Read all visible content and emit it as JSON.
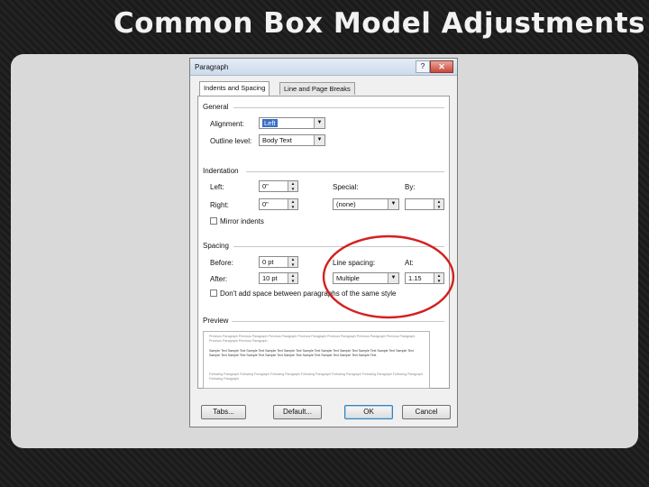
{
  "slide": {
    "title": "Common Box Model Adjustments"
  },
  "dialog": {
    "title": "Paragraph",
    "help_label": "?",
    "close_label": "✕",
    "tabs": [
      {
        "label": "Indents and Spacing",
        "active": true
      },
      {
        "label": "Line and Page Breaks",
        "active": false
      }
    ],
    "general": {
      "heading": "General",
      "alignment_label": "Alignment:",
      "alignment_value": "Left",
      "outline_label": "Outline level:",
      "outline_value": "Body Text"
    },
    "indentation": {
      "heading": "Indentation",
      "left_label": "Left:",
      "left_value": "0\"",
      "right_label": "Right:",
      "right_value": "0\"",
      "special_label": "Special:",
      "special_value": "(none)",
      "by_label": "By:",
      "by_value": "",
      "mirror_label": "Mirror indents"
    },
    "spacing": {
      "heading": "Spacing",
      "before_label": "Before:",
      "before_value": "0 pt",
      "after_label": "After:",
      "after_value": "10 pt",
      "line_spacing_label": "Line spacing:",
      "line_spacing_value": "Multiple",
      "at_label": "At:",
      "at_value": "1.15",
      "dont_add_label": "Don't add space between paragraphs of the same style"
    },
    "preview": {
      "heading": "Preview",
      "previous_text": "Previous Paragraph Previous Paragraph Previous Paragraph Previous Paragraph Previous Paragraph Previous Paragraph Previous Paragraph Previous Paragraph Previous Paragraph",
      "sample_text": "Sample Text Sample Text Sample Text Sample Text Sample Text Sample Text Sample Text Sample Text Sample Text Sample Text Sample Text Sample Text Sample Text Sample Text Sample Text Sample Text Sample Text Sample Text Sample Text Sample Text",
      "following_text": "Following Paragraph Following Paragraph Following Paragraph Following Paragraph Following Paragraph Following Paragraph Following Paragraph Following Paragraph"
    },
    "buttons": {
      "tabs_label": "Tabs...",
      "default_label": "Default...",
      "ok_label": "OK",
      "cancel_label": "Cancel"
    }
  },
  "annotation": {
    "color": "#d42020"
  }
}
